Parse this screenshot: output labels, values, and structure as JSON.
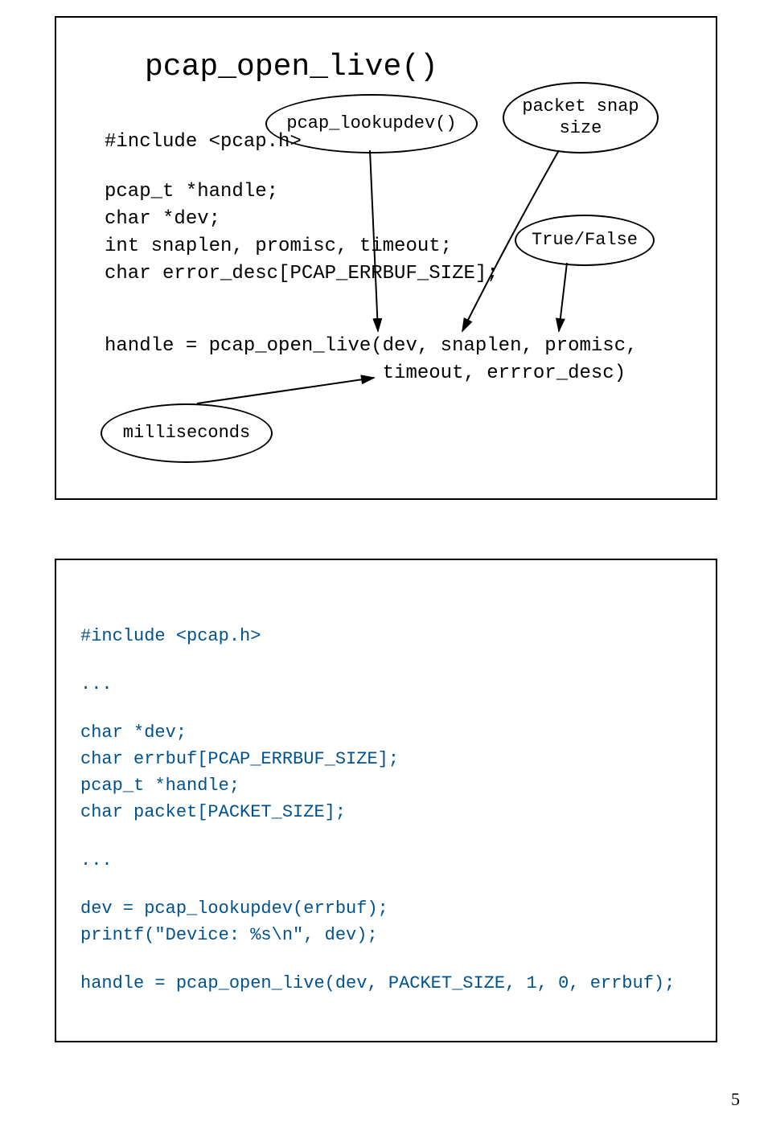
{
  "slide1": {
    "title": "pcap_open_live()",
    "include": "#include <pcap.h>",
    "decl1": "pcap_t *handle;",
    "decl2": "char *dev;",
    "decl3": "int snaplen, promisc, timeout;",
    "decl4": "char error_desc[PCAP_ERRBUF_SIZE];",
    "call1": "handle = pcap_open_live(dev, snaplen, promisc,",
    "call2": "                        timeout, errror_desc)",
    "bubble_lookup": "pcap_lookupdev()",
    "bubble_snap": "packet snap\nsize",
    "bubble_tf": "True/False",
    "bubble_ms": "milliseconds"
  },
  "slide2": {
    "line1": "#include <pcap.h>",
    "line2": "...",
    "line3": "char *dev;",
    "line4": "char errbuf[PCAP_ERRBUF_SIZE];",
    "line5": "pcap_t *handle;",
    "line6": "char packet[PACKET_SIZE];",
    "line7": "...",
    "line8": "dev = pcap_lookupdev(errbuf);",
    "line9": "printf(\"Device: %s\\n\", dev);",
    "line10": "handle = pcap_open_live(dev, PACKET_SIZE, 1, 0, errbuf);"
  },
  "page": "5"
}
